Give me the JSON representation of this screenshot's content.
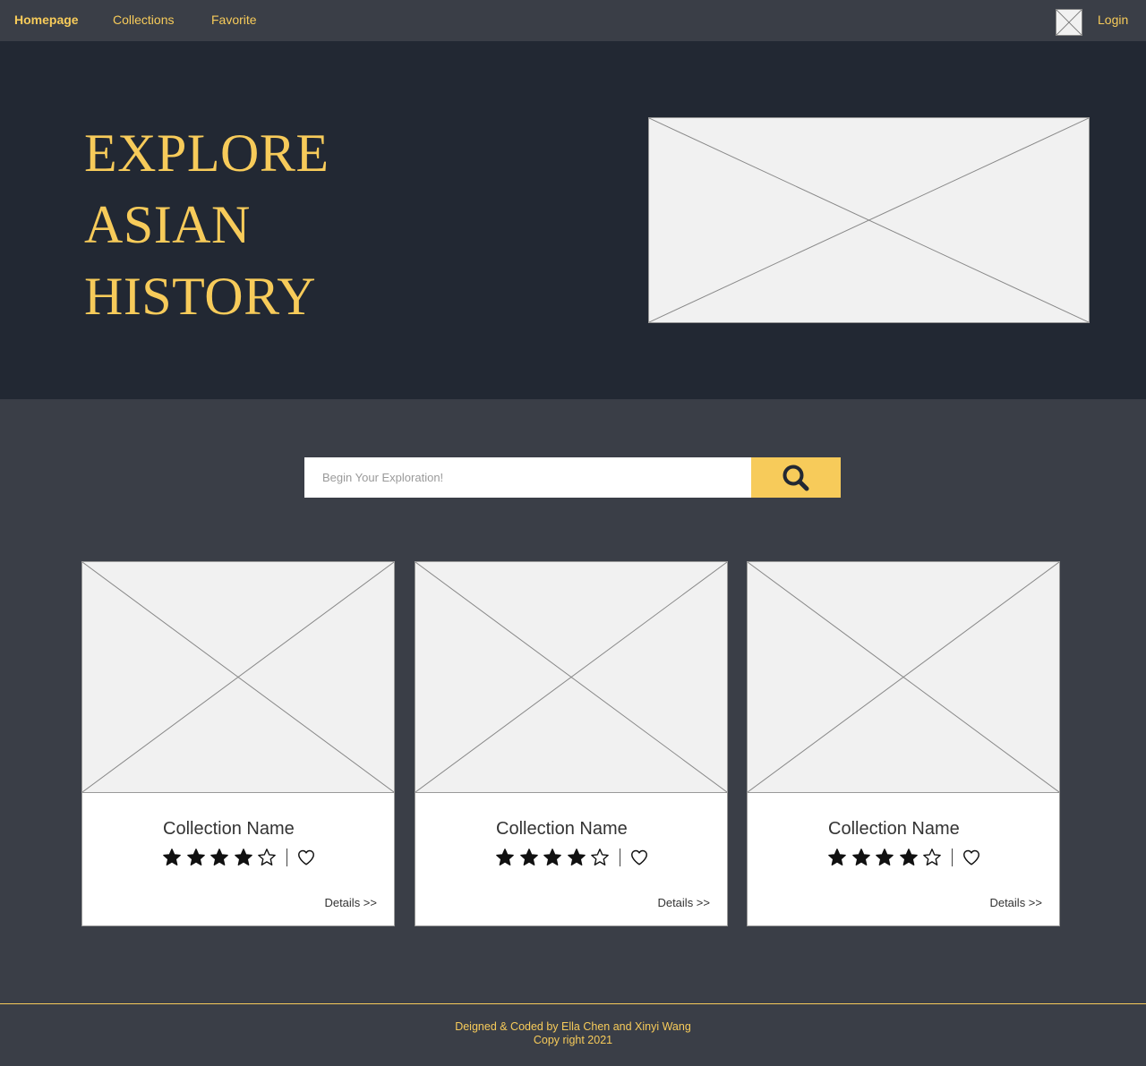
{
  "nav": {
    "homepage": "Homepage",
    "collections": "Collections",
    "favorite": "Favorite",
    "login": "Login"
  },
  "hero": {
    "title_lines": [
      "EXPLORE",
      "ASIAN",
      "HISTORY"
    ]
  },
  "search": {
    "placeholder": "Begin Your Exploration!"
  },
  "cards": [
    {
      "title": "Collection Name",
      "rating": 4,
      "rating_max": 5,
      "details": "Details >>"
    },
    {
      "title": "Collection Name",
      "rating": 4,
      "rating_max": 5,
      "details": "Details >>"
    },
    {
      "title": "Collection Name",
      "rating": 4,
      "rating_max": 5,
      "details": "Details >>"
    }
  ],
  "footer": {
    "credit": "Deigned & Coded by Ella Chen and Xinyi Wang",
    "copyright": "Copy right 2021"
  },
  "colors": {
    "accent": "#f7cb5a",
    "hero_bg": "#222833",
    "page_bg": "#3a3e47"
  }
}
